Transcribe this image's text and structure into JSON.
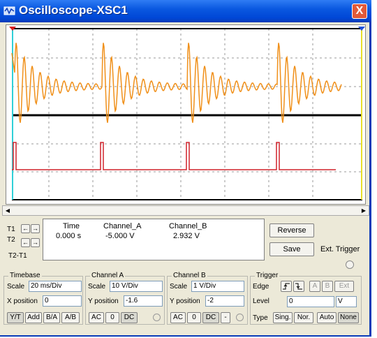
{
  "window": {
    "title": "Oscilloscope-XSC1",
    "close_label": "X"
  },
  "readout": {
    "headers": [
      "Time",
      "Channel_A",
      "Channel_B"
    ],
    "rows": [
      {
        "label": "T1",
        "time": "0.000 s",
        "channel_a": "-5.000 V",
        "channel_b": "2.932 V"
      }
    ],
    "t2_label": "T2",
    "t2t1_label": "T2-T1"
  },
  "buttons": {
    "reverse": "Reverse",
    "save": "Save",
    "ext_trigger": "Ext. Trigger"
  },
  "timebase": {
    "title": "Timebase",
    "scale_label": "Scale",
    "scale": "20 ms/Div",
    "xpos_label": "X position",
    "xpos": "0",
    "modes": [
      "Y/T",
      "Add",
      "B/A",
      "A/B"
    ],
    "selected_mode": "Y/T"
  },
  "channel_a": {
    "title": "Channel A",
    "scale_label": "Scale",
    "scale": "10  V/Div",
    "ypos_label": "Y position",
    "ypos": "-1.6",
    "coupling": [
      "AC",
      "0",
      "DC"
    ],
    "selected": "DC"
  },
  "channel_b": {
    "title": "Channel B",
    "scale_label": "Scale",
    "scale": "1  V/Div",
    "ypos_label": "Y position",
    "ypos": "-2",
    "coupling": [
      "AC",
      "0",
      "DC",
      "-"
    ],
    "selected": "DC"
  },
  "trigger": {
    "title": "Trigger",
    "edge_label": "Edge",
    "sources": [
      "A",
      "B",
      "Ext"
    ],
    "level_label": "Level",
    "level": "0",
    "level_unit": "V",
    "type_label": "Type",
    "types": [
      "Sing.",
      "Nor.",
      "Auto",
      "None"
    ],
    "selected_type": "None"
  },
  "colors": {
    "channel_a": "#f0901a",
    "channel_b": "#d0242c",
    "title_bar": "#0a58e0"
  }
}
